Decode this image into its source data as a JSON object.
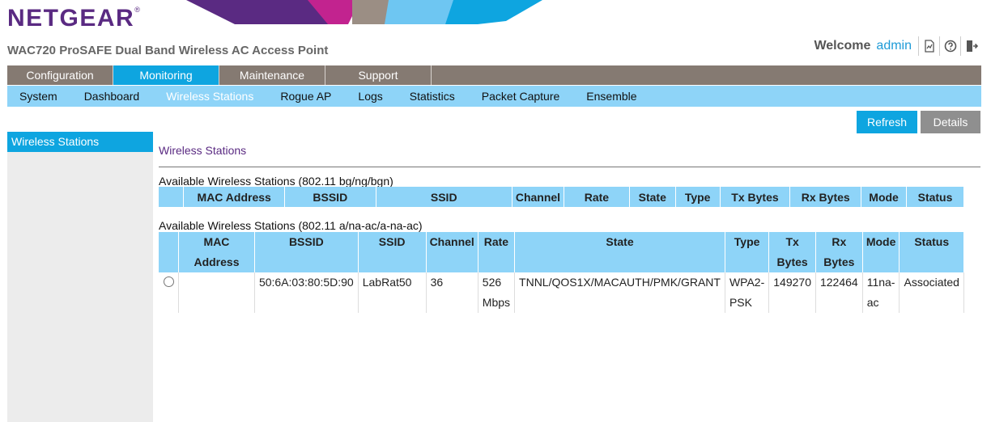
{
  "header": {
    "logo": "NETGEAR",
    "product_title": "WAC720 ProSAFE Dual Band Wireless AC Access Point",
    "welcome_label": "Welcome",
    "username": "admin",
    "icons": [
      "status-icon",
      "help-icon",
      "logout-icon"
    ]
  },
  "main_tabs": [
    {
      "label": "Configuration",
      "active": false
    },
    {
      "label": "Monitoring",
      "active": true
    },
    {
      "label": "Maintenance",
      "active": false
    },
    {
      "label": "Support",
      "active": false
    }
  ],
  "sub_tabs": [
    {
      "label": "System",
      "active": false
    },
    {
      "label": "Dashboard",
      "active": false
    },
    {
      "label": "Wireless Stations",
      "active": true
    },
    {
      "label": "Rogue AP",
      "active": false
    },
    {
      "label": "Logs",
      "active": false
    },
    {
      "label": "Statistics",
      "active": false
    },
    {
      "label": "Packet Capture",
      "active": false
    },
    {
      "label": "Ensemble",
      "active": false
    }
  ],
  "actions": {
    "refresh": "Refresh",
    "details": "Details"
  },
  "sidebar": {
    "items": [
      {
        "label": "Wireless Stations",
        "active": true
      }
    ]
  },
  "content": {
    "title": "Wireless Stations",
    "table_bg": {
      "caption": "Available Wireless Stations (802.11 bg/ng/bgn)",
      "headers": [
        "MAC Address",
        "BSSID",
        "SSID",
        "Channel",
        "Rate",
        "State",
        "Type",
        "Tx Bytes",
        "Rx Bytes",
        "Mode",
        "Status"
      ],
      "rows": []
    },
    "table_ac": {
      "caption": "Available Wireless Stations (802.11 a/na-ac/a-na-ac)",
      "headers": [
        "MAC Address",
        "BSSID",
        "SSID",
        "Channel",
        "Rate",
        "State",
        "Type",
        "Tx Bytes",
        "Rx Bytes",
        "Mode",
        "Status"
      ],
      "rows": [
        {
          "mac_address": "",
          "bssid": "50:6A:03:80:5D:90",
          "ssid": "LabRat50",
          "channel": "36",
          "rate": "526 Mbps",
          "state": "TNNL/QOS1X/MACAUTH/PMK/GRANT",
          "type": "WPA2-PSK",
          "tx_bytes": "149270",
          "rx_bytes": "122464",
          "mode": "11na-ac",
          "status": "Associated"
        }
      ]
    }
  },
  "colors": {
    "brand": "#5a2a82",
    "accent": "#0ea5e0",
    "tab_bar": "#857a72",
    "subtab_bar": "#8ed4f8",
    "sidebar": "#ececec"
  }
}
